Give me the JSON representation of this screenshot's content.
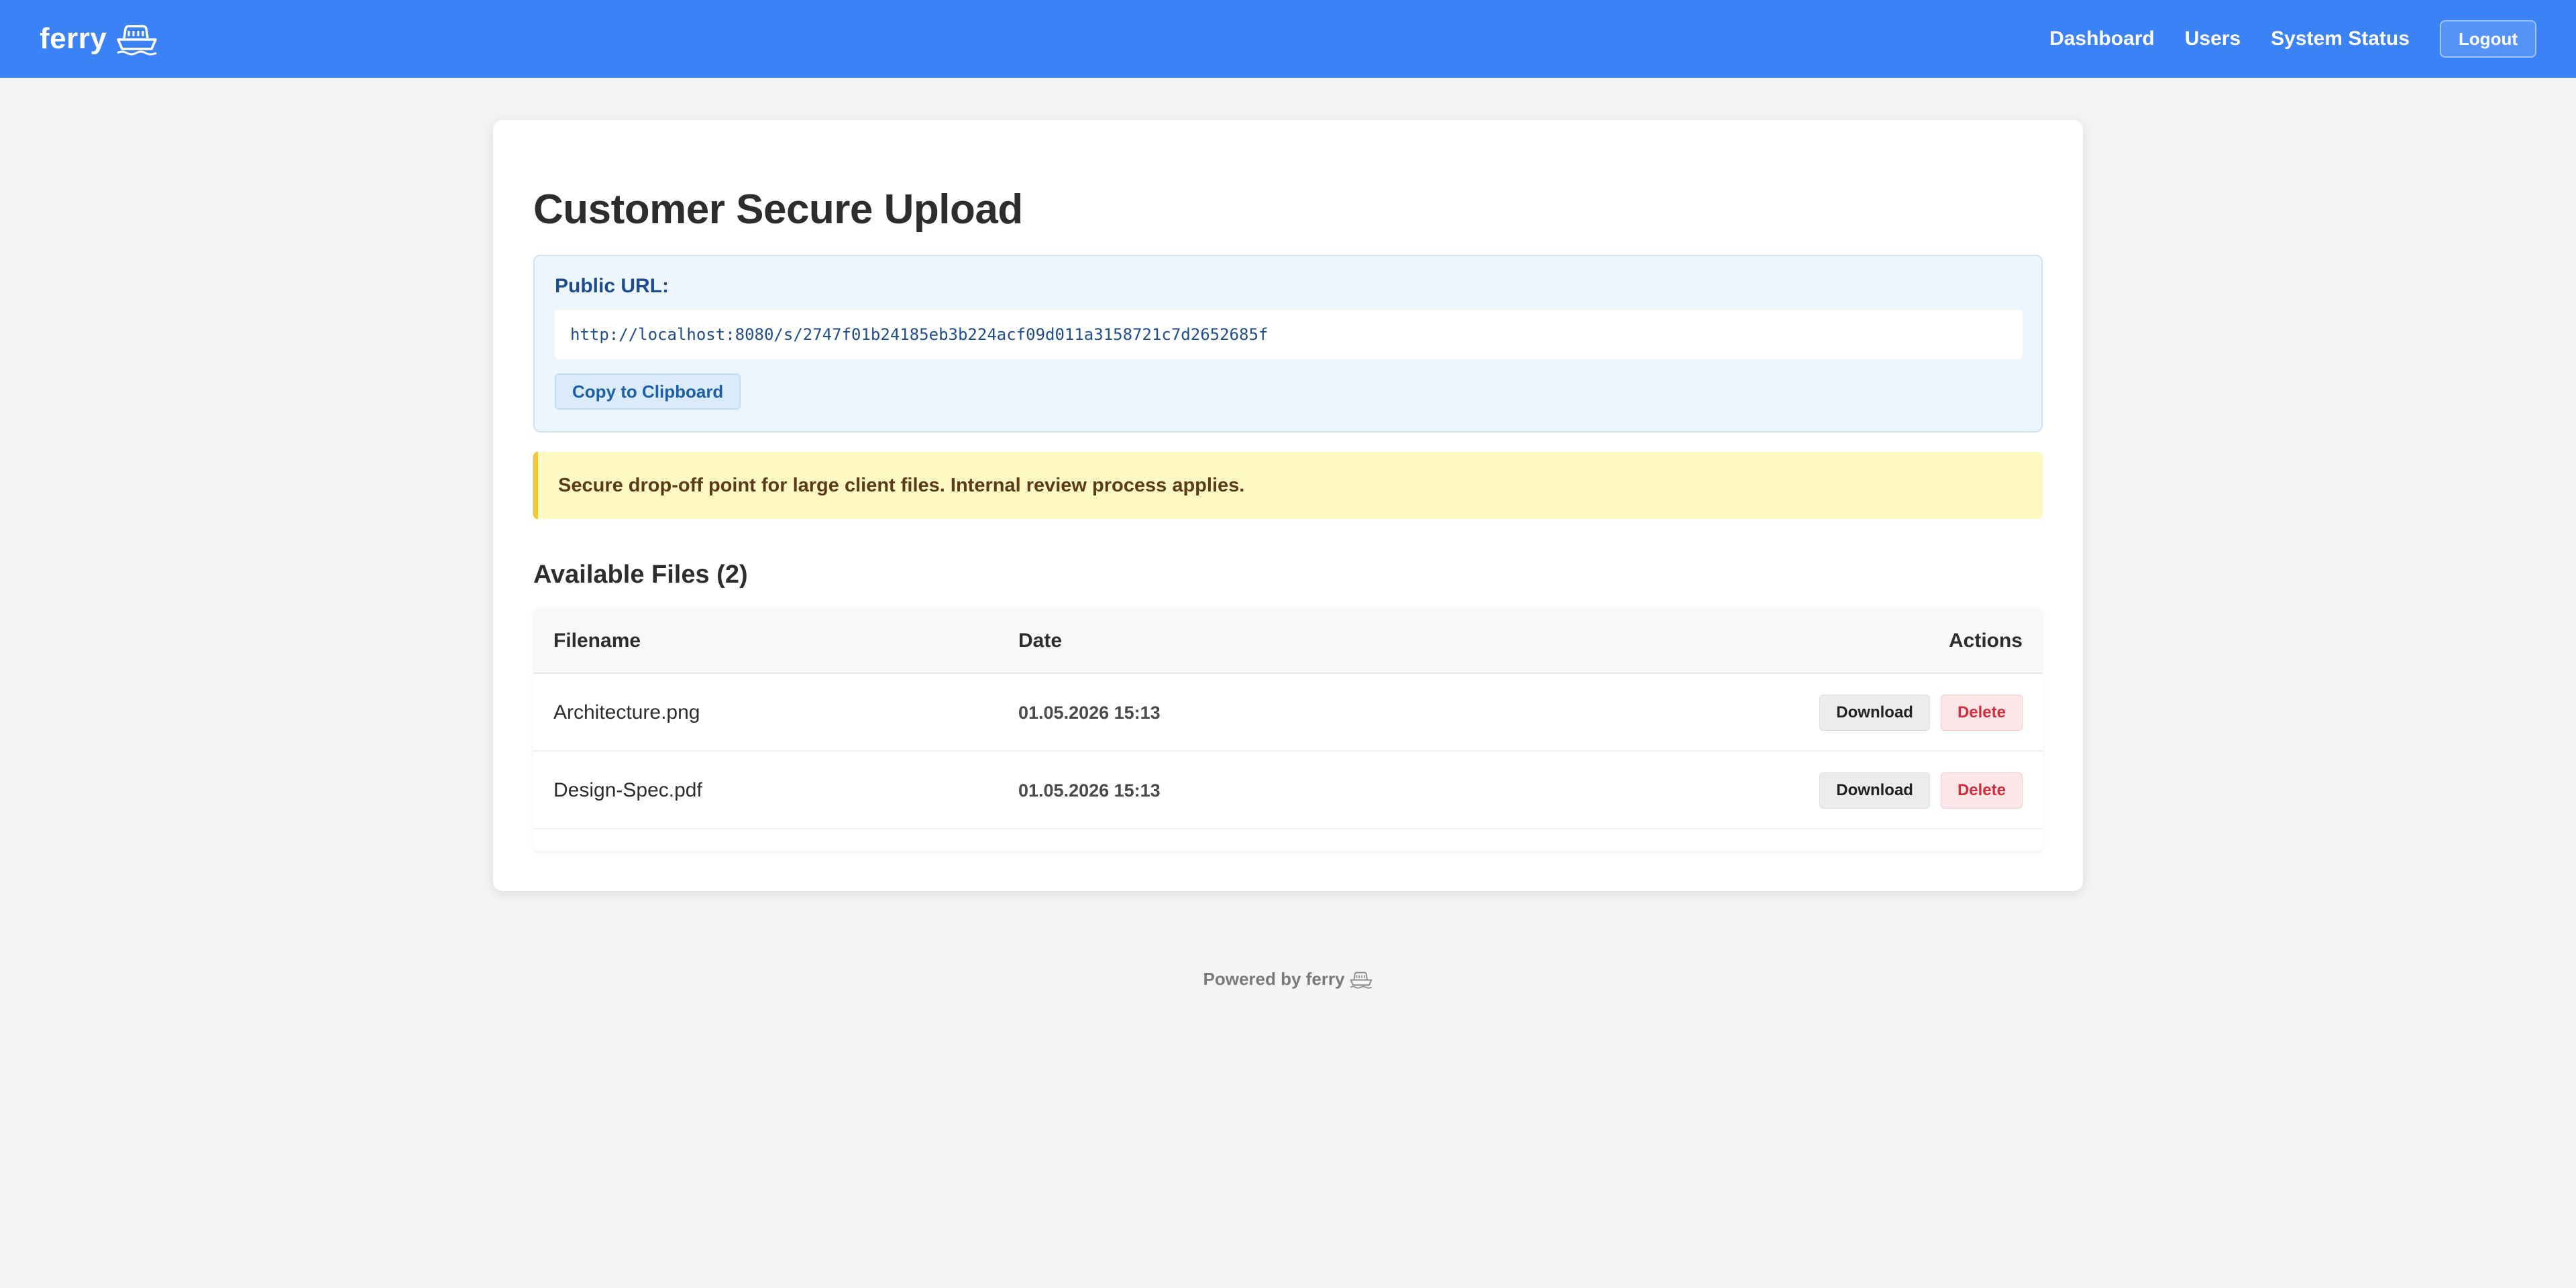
{
  "nav": {
    "brand": "ferry",
    "brand_icon": "ferry-boat-icon",
    "links": [
      "Dashboard",
      "Users",
      "System Status"
    ],
    "logout_label": "Logout",
    "accent_color": "#3b82f6"
  },
  "main": {
    "title": "Customer Secure Upload",
    "public_url": {
      "label": "Public URL:",
      "value": "http://localhost:8080/s/2747f01b24185eb3b224acf09d011a3158721c7d2652685f",
      "copy_label": "Copy to Clipboard"
    },
    "notice": "Secure drop-off point for large client files. Internal review process applies.",
    "files": {
      "heading": "Available Files (2)",
      "columns": [
        "Filename",
        "Date",
        "Actions"
      ],
      "rows": [
        {
          "filename": "Architecture.png",
          "date": "01.05.2026 15:13",
          "download_label": "Download",
          "delete_label": "Delete"
        },
        {
          "filename": "Design-Spec.pdf",
          "date": "01.05.2026 15:13",
          "download_label": "Download",
          "delete_label": "Delete"
        }
      ]
    }
  },
  "footer": {
    "text": "Powered by ferry",
    "icon": "ferry-boat-icon"
  }
}
